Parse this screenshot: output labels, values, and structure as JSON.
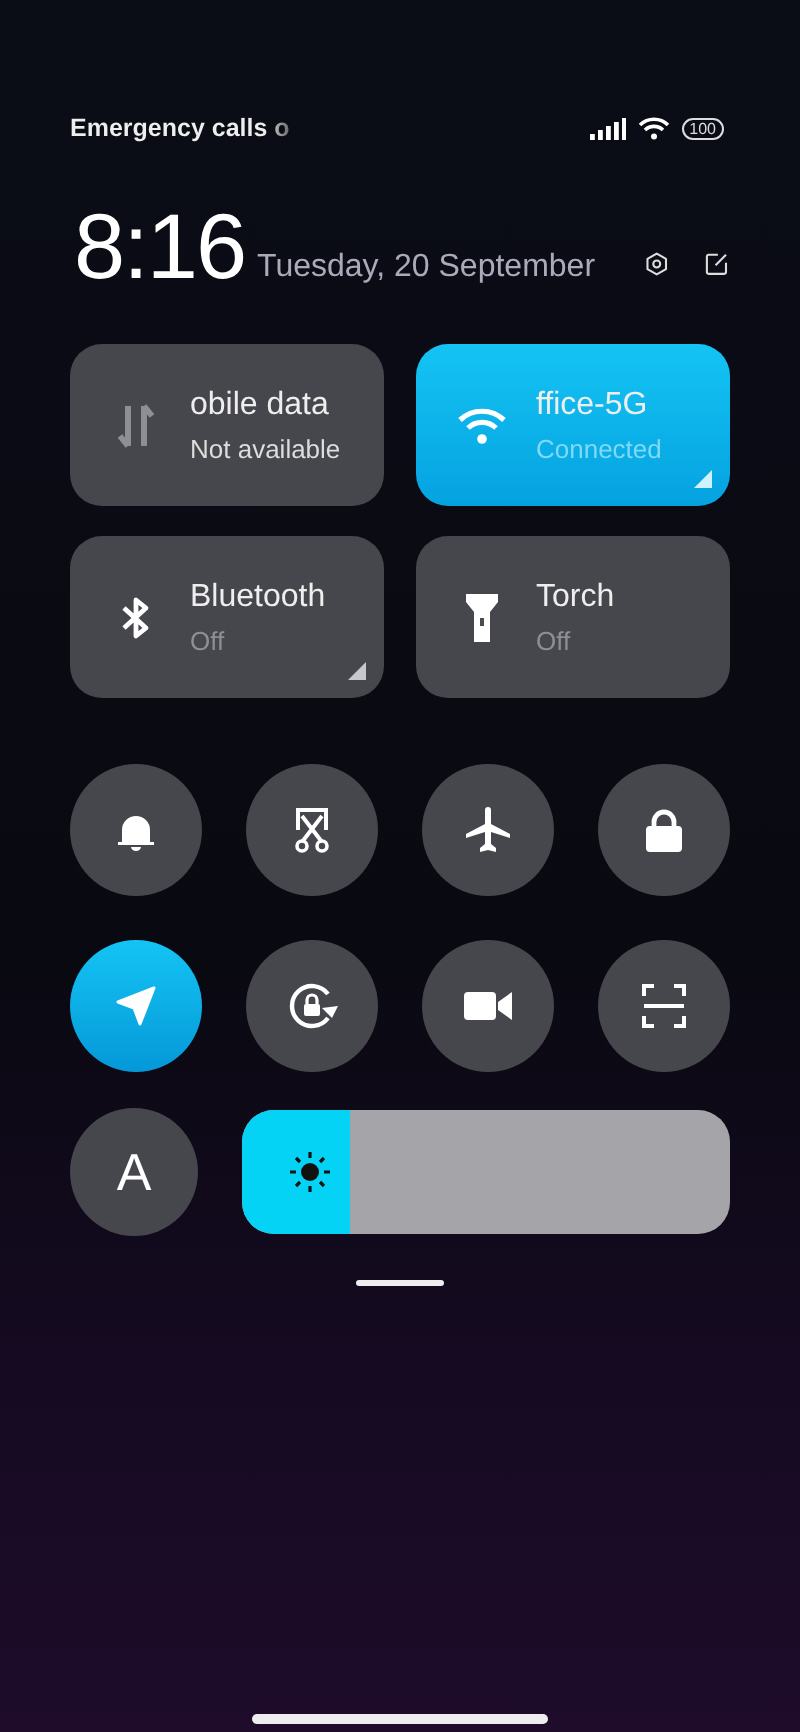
{
  "status_bar": {
    "carrier": "Emergency calls o",
    "battery": "100"
  },
  "header": {
    "time": "8:16",
    "date": "Tuesday, 20 September"
  },
  "tiles": [
    {
      "title": "obile data",
      "subtitle": "Not available",
      "on": false,
      "disabled": true,
      "expandable": false
    },
    {
      "title": "ffice-5G",
      "subtitle": "Connected",
      "on": true,
      "disabled": false,
      "expandable": true
    },
    {
      "title": "Bluetooth",
      "subtitle": "Off",
      "on": false,
      "disabled": false,
      "expandable": true
    },
    {
      "title": "Torch",
      "subtitle": "Off",
      "on": false,
      "disabled": false,
      "expandable": false
    }
  ],
  "toggles": [
    {
      "on": false
    },
    {
      "on": false
    },
    {
      "on": false
    },
    {
      "on": false
    },
    {
      "on": true
    },
    {
      "on": false
    },
    {
      "on": false
    },
    {
      "on": false
    }
  ],
  "bottom_row": {
    "font_button": {
      "label": "A",
      "on": false
    },
    "brightness": {
      "level": 0.22
    }
  }
}
